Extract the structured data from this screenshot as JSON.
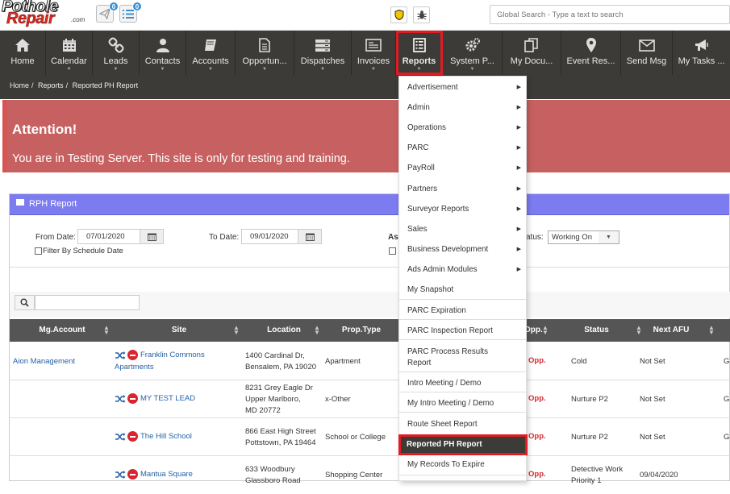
{
  "logo": {
    "line1": "Pothole",
    "line2": "Repair",
    "suffix": ".com"
  },
  "topbar": {
    "badge_send": "0",
    "badge_list": "0",
    "search_placeholder": "Global Search - Type a text to search"
  },
  "nav": [
    {
      "label": "Home",
      "icon": "home-icon"
    },
    {
      "label": "Calendar",
      "icon": "calendar-icon"
    },
    {
      "label": "Leads",
      "icon": "link-icon"
    },
    {
      "label": "Contacts",
      "icon": "person-icon"
    },
    {
      "label": "Accounts",
      "icon": "book-icon"
    },
    {
      "label": "Opportun...",
      "icon": "document-icon"
    },
    {
      "label": "Dispatches",
      "icon": "server-icon"
    },
    {
      "label": "Invoices",
      "icon": "invoice-icon"
    },
    {
      "label": "Reports",
      "icon": "report-icon"
    },
    {
      "label": "System P...",
      "icon": "gears-icon"
    },
    {
      "label": "My Docu...",
      "icon": "copy-icon"
    },
    {
      "label": "Event Res...",
      "icon": "map-marker-icon"
    },
    {
      "label": "Send Msg",
      "icon": "envelope-icon"
    },
    {
      "label": "My Tasks ...",
      "icon": "megaphone-icon"
    }
  ],
  "breadcrumb": {
    "home": "Home",
    "sep": "/",
    "reports": "Reports",
    "current": "Reported PH Report"
  },
  "alert": {
    "title": "Attention!",
    "message": "You are in Testing Server. This site is only for testing and training."
  },
  "panel": {
    "title": "RPH Report"
  },
  "filters": {
    "from_label": "From Date:",
    "from_value": "07/01/2020",
    "to_label": "To Date:",
    "to_value": "09/01/2020",
    "schedule_label": "Filter By Schedule Date",
    "as_label": "As",
    "status_label": "atus:",
    "status_value": "Working On"
  },
  "table": {
    "columns": [
      "Mg.Account",
      "Site",
      "Location",
      "Prop.Type",
      "Opp.",
      "Status",
      "Next AFU"
    ],
    "rows": [
      {
        "account": "Aion Management",
        "site_line1": "Franklin Commons",
        "site_line2": "Apartments",
        "location_line1": "1400 Cardinal Dr,",
        "location_line2": "Bensalem, PA 19020",
        "location_line3": "",
        "prop_type": "Apartment",
        "opp": "Opp.",
        "status_line1": "Cold",
        "status_line2": "",
        "next_afu": "Not Set",
        "extra": "G"
      },
      {
        "account": "",
        "site_line1": "MY TEST LEAD",
        "site_line2": "",
        "location_line1": "8231 Grey Eagle Dr",
        "location_line2": "Upper Marlboro,",
        "location_line3": "MD 20772",
        "prop_type": "x-Other",
        "opp": "Opp.",
        "status_line1": "Nurture P2",
        "status_line2": "",
        "next_afu": "Not Set",
        "extra": "G"
      },
      {
        "account": "",
        "site_line1": "The Hill School",
        "site_line2": "",
        "location_line1": "866 East High Street",
        "location_line2": "Pottstown, PA 19464",
        "location_line3": "",
        "prop_type": "School or College",
        "opp": "Opp.",
        "status_line1": "Nurture P2",
        "status_line2": "",
        "next_afu": "Not Set",
        "extra": "G"
      },
      {
        "account": "",
        "site_line1": "Mantua Square",
        "site_line2": "",
        "location_line1": "633 Woodbury",
        "location_line2": "Glassboro Road",
        "location_line3": "",
        "prop_type": "Shopping Center",
        "opp": "Opp.",
        "status_line1": "Detective Work",
        "status_line2": "Priority 1",
        "next_afu": "09/04/2020",
        "extra": ""
      }
    ]
  },
  "reports_menu": [
    {
      "label": "Advertisement",
      "submenu": true
    },
    {
      "label": "Admin",
      "submenu": true
    },
    {
      "label": "Operations",
      "submenu": true
    },
    {
      "label": "PARC",
      "submenu": true
    },
    {
      "label": "PayRoll",
      "submenu": true
    },
    {
      "label": "Partners",
      "submenu": true
    },
    {
      "label": "Surveyor Reports",
      "submenu": true
    },
    {
      "label": "Sales",
      "submenu": true
    },
    {
      "label": "Business Development",
      "submenu": true
    },
    {
      "label": "Ads Admin Modules",
      "submenu": true
    },
    {
      "label": "My Snapshot",
      "submenu": false
    },
    {
      "label": "PARC Expiration",
      "submenu": false
    },
    {
      "label": "PARC Inspection Report",
      "submenu": false
    },
    {
      "label": "PARC Process Results Report",
      "submenu": false
    },
    {
      "label": "Intro Meeting / Demo",
      "submenu": false
    },
    {
      "label": "My Intro Meeting / Demo",
      "submenu": false
    },
    {
      "label": "Route Sheet Report",
      "submenu": false
    },
    {
      "label": "Reported PH Report",
      "submenu": false
    },
    {
      "label": "My Records To Expire",
      "submenu": false
    }
  ],
  "colors": {
    "nav_bg": "#3d3b38",
    "highlight": "#e21b23",
    "alert_bg": "#c76060",
    "panel_header": "#7c7cf0",
    "link": "#2462a8",
    "opp": "#d9262e"
  }
}
